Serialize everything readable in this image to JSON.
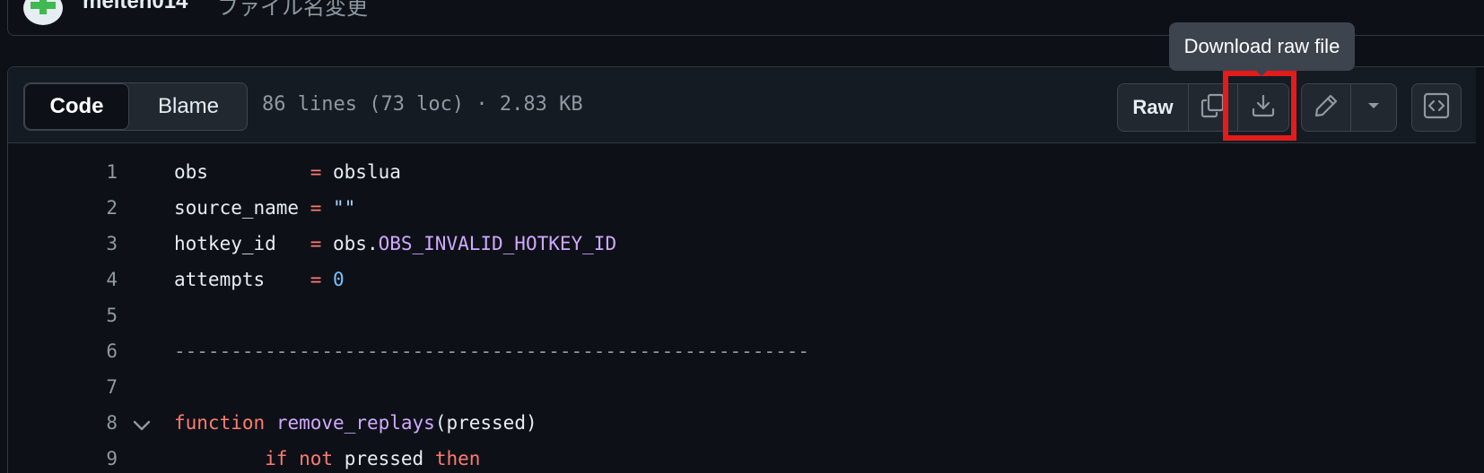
{
  "commit": {
    "author": "meiten014",
    "message": "ファイル名変更"
  },
  "file_header": {
    "tabs": [
      {
        "label": "Code",
        "active": true
      },
      {
        "label": "Blame",
        "active": false
      }
    ],
    "info": "86 lines (73 loc) · 2.83 KB",
    "raw_label": "Raw",
    "copy_icon": "copy-icon",
    "download_icon": "download-icon",
    "edit_icon": "pencil-icon",
    "more_icon": "triangle-down-icon",
    "symbols_icon": "code-square-icon"
  },
  "tooltip": {
    "text": "Download raw file"
  },
  "highlight_color": "#e31b1b",
  "code_lines": [
    {
      "num": "1",
      "tokens": [
        [
          "t-plain",
          "obs         "
        ],
        [
          "t-op",
          "="
        ],
        [
          "t-plain",
          " obslua"
        ]
      ]
    },
    {
      "num": "2",
      "tokens": [
        [
          "t-plain",
          "source_name "
        ],
        [
          "t-op",
          "="
        ],
        [
          "t-plain",
          " "
        ],
        [
          "t-str",
          "\"\""
        ]
      ]
    },
    {
      "num": "3",
      "tokens": [
        [
          "t-plain",
          "hotkey_id   "
        ],
        [
          "t-op",
          "="
        ],
        [
          "t-plain",
          " obs."
        ],
        [
          "t-const",
          "OBS_INVALID_HOTKEY_ID"
        ]
      ]
    },
    {
      "num": "4",
      "tokens": [
        [
          "t-plain",
          "attempts    "
        ],
        [
          "t-op",
          "="
        ],
        [
          "t-plain",
          " "
        ],
        [
          "t-num",
          "0"
        ]
      ]
    },
    {
      "num": "5",
      "tokens": []
    },
    {
      "num": "6",
      "tokens": [
        [
          "t-cmt",
          "--------------------------------------------------------"
        ]
      ]
    },
    {
      "num": "7",
      "tokens": []
    },
    {
      "num": "8",
      "fold": true,
      "tokens": [
        [
          "t-kw",
          "function"
        ],
        [
          "t-plain",
          " "
        ],
        [
          "t-fn",
          "remove_replays"
        ],
        [
          "t-plain",
          "(pressed)"
        ]
      ]
    },
    {
      "num": "9",
      "tokens": [
        [
          "t-plain",
          "        "
        ],
        [
          "t-kw",
          "if"
        ],
        [
          "t-plain",
          " "
        ],
        [
          "t-kw",
          "not"
        ],
        [
          "t-plain",
          " pressed "
        ],
        [
          "t-kw",
          "then"
        ]
      ]
    }
  ]
}
